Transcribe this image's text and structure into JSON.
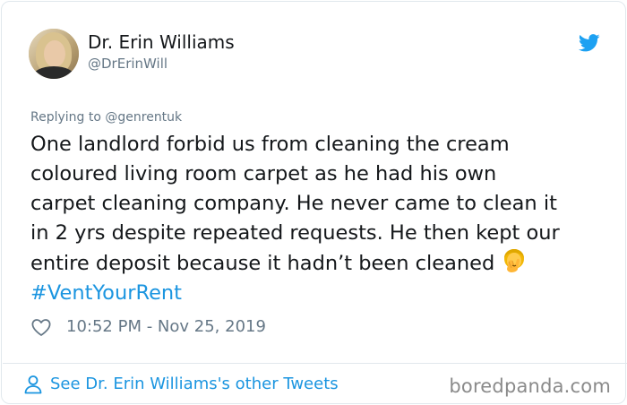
{
  "author": {
    "name": "Dr. Erin Williams",
    "handle": "@DrErinWill"
  },
  "tweet": {
    "reply_to": "Replying to @genrentuk",
    "lines": [
      "One landlord forbid us from cleaning the cream",
      "coloured living room carpet as he had his own",
      "carpet cleaning company. He never came to clean it",
      "in 2 yrs despite repeated requests. He then kept our",
      "entire deposit because it hadn’t been cleaned"
    ],
    "hashtag": "#VentYourRent",
    "emoji": "face-palm-emoji",
    "timestamp": "10:52 PM - Nov 25, 2019"
  },
  "footer": {
    "see_more": "See Dr. Erin Williams's other Tweets",
    "watermark": "boredpanda.com"
  },
  "icons": {
    "brand": "twitter-bird-icon",
    "like": "heart-icon",
    "profile": "person-icon"
  },
  "colors": {
    "link": "#1b95e0",
    "secondary_text": "#657786",
    "twitter_blue": "#1da1f2",
    "border": "#e1e8ed"
  }
}
